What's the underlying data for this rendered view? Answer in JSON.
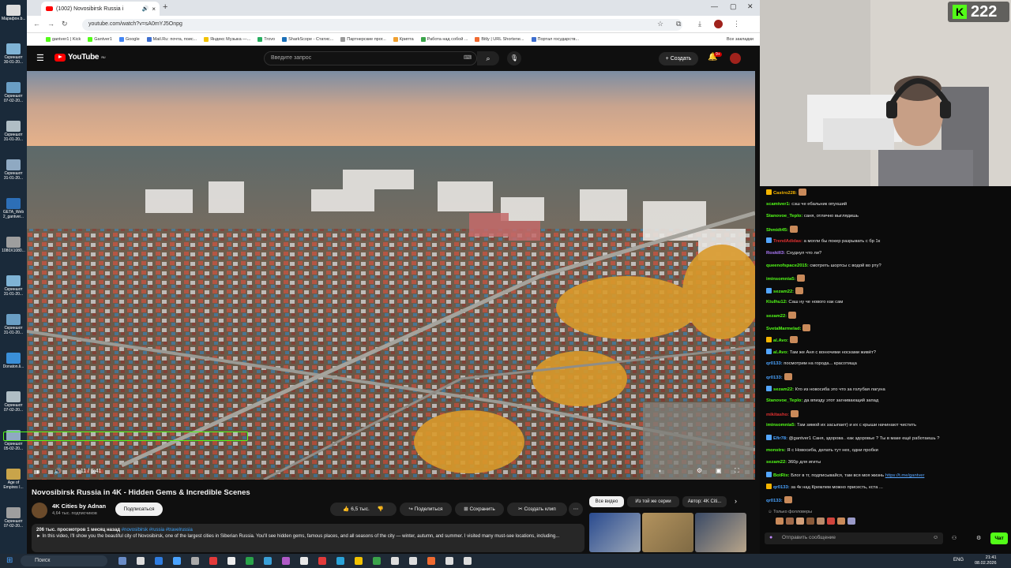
{
  "desktop": {
    "items": [
      "Марафон.b...",
      "Скриншот 30-01-20...",
      "Скриншот 07-02-20...",
      "Скриншот 31-01-20...",
      "Скриншот 31-01-20...",
      "GETA_Web 2_gantver...",
      "1080X1080...",
      "Скриншот 31-01-20...",
      "Скриншот 31-01-20...",
      "Donaton.li...",
      "Скриншот 07-02-20...",
      "Скриншот 05-02-20...",
      "Age of Empires I...",
      "Скриншот 07-02-20..."
    ]
  },
  "browser": {
    "tab_title": "(1002) Novosibirsk Russia i",
    "new_tab": "+",
    "url": "youtube.com/watch?v=sA0mYJ5Onpg",
    "bookmarks": [
      "gantver1 | Kick",
      "Gantver1",
      "Google",
      "Mail.Ru: почта, поис...",
      "Яндекс Музыка —...",
      "Trovo",
      "SharkScope - Статис...",
      "Партнерские прог...",
      "Криптa",
      "Работа над собой ...",
      "Bitly | URL Shortene...",
      "Портал государств..."
    ],
    "all_bookmarks": "Все закладки"
  },
  "youtube": {
    "logo": "YouTube",
    "logo_region": "RU",
    "search_placeholder": "Введите запрос",
    "create_label": "Создать",
    "notif_count": "9+",
    "player": {
      "time": "1:11 / 5:41",
      "progress": 0.208
    },
    "video_title": "Novosibirsk Russia in 4K - Hidden Gems & Incredible Scenes",
    "channel_name": "4K Cities by Adnan",
    "channel_subs": "4,64 тыс. подписчиков",
    "subscribe": "Подписаться",
    "likes": "6,5 тыс.",
    "share": "Поделиться",
    "save": "Сохранить",
    "clip": "Создать клип",
    "more": "⋯",
    "desc_meta": "206 тыс. просмотров  1 месяц назад",
    "desc_tags": "#novosibirsk #russia #travelrussia",
    "desc_text": "► In this video, I'll show you the beautiful city of Novosibirsk, one of the largest cities in Siberian Russia. You'll see hidden gems, famous places, and all seasons of the city — winter, autumn, and summer. I visited many must-see locations, including...",
    "chips": [
      "Все видео",
      "Из той же серии",
      "Автор: 4K Citi..."
    ]
  },
  "stream": {
    "viewers": "222",
    "platform_logo": "K"
  },
  "chat": {
    "messages": [
      {
        "user": "Castro228:",
        "text": "",
        "color": "#f4b400"
      },
      {
        "user": "scamtver1:",
        "text": " сэш че ебальник опухший",
        "color": "#53fc18"
      },
      {
        "user": "Stanovoe_Teplo:",
        "text": " саня, отлично выглядишь",
        "color": "#53fc18"
      },
      {
        "user": "Shmidt45:",
        "text": "",
        "color": "#53fc18"
      },
      {
        "user": "TrendAdidas:",
        "text": " а могли бы покер разрывать с бр 1к",
        "color": "#e03030"
      },
      {
        "user": "Roskill3:",
        "text": " Схуднул что ли?",
        "color": "#b07cff"
      },
      {
        "user": "queenofspace2015:",
        "text": " смотреть шортсы с водой во рту?",
        "color": "#53fc18"
      },
      {
        "user": "iminsomnia5:",
        "text": "",
        "color": "#53fc18"
      },
      {
        "user": "sezam22:",
        "text": "",
        "color": "#53fc18"
      },
      {
        "user": "Ktulhu12:",
        "text": " Саш ну че нового как сам",
        "color": "#53fc18"
      },
      {
        "user": "sezam22:",
        "text": "",
        "color": "#53fc18"
      },
      {
        "user": "SvetaMarmelad:",
        "text": "",
        "color": "#53fc18"
      },
      {
        "user": "al.Avo:",
        "text": "",
        "color": "#53fc18"
      },
      {
        "user": "al.Avo:",
        "text": " Там же Аня с вонючими носками живёт?",
        "color": "#53fc18"
      },
      {
        "user": "qr0133:",
        "text": " посмотрим на города... красотища",
        "color": "#4aa3ff"
      },
      {
        "user": "qr0133:",
        "text": "",
        "color": "#4aa3ff"
      },
      {
        "user": "sezam22:",
        "text": " Кто из новосиба это что за голубая лагуна",
        "color": "#53fc18"
      },
      {
        "user": "Stanovoe_Teplo:",
        "text": " да впизду этот загнивающий запад",
        "color": "#53fc18"
      },
      {
        "user": "mikitasho:",
        "text": "",
        "color": "#e03030"
      },
      {
        "user": "iminsomnia5:",
        "text": " Там зимой их засыпает) и их с крыши начинают чистить",
        "color": "#53fc18"
      },
      {
        "user": "Efir78:",
        "text": " @gantver1 Саня, здорова . как здоровье ? Ты в маке ещё работаешь ?",
        "color": "#4aa3ff"
      },
      {
        "user": "monstrs:",
        "text": " Я с Новосиба, делать тут нех, одни пробки",
        "color": "#53fc18"
      },
      {
        "user": "sezam22:",
        "text": " 360р для игиты",
        "color": "#53fc18"
      },
      {
        "user": "BotRix:",
        "text": " Блог в тг, подписывайся, там вся моя жизнь ",
        "link": "https://t.me/gantver",
        "color": "#53fc18"
      },
      {
        "user": "qr0133:",
        "text": " за 4к над Кремлем можно присесть, кста ...",
        "color": "#4aa3ff"
      },
      {
        "user": "qr0133:",
        "text": "",
        "color": "#4aa3ff"
      }
    ],
    "followers_label": "Только фолловеры",
    "input_placeholder": "Отправить сообщение",
    "send_label": "Чат"
  },
  "taskbar": {
    "search": "Поиск",
    "lang": "ENG",
    "time": "21:41",
    "date": "08.02.2026"
  }
}
